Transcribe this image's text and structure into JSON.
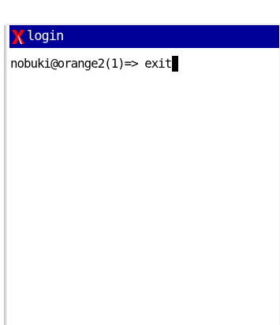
{
  "window": {
    "title": "login",
    "app_icon": "x-window-icon"
  },
  "terminal": {
    "command_line": "nobuki@orange2(1)=> exit",
    "cursor": "block-cursor"
  },
  "colors": {
    "titlebar": "#000099",
    "title_text": "#ffffff",
    "icon": "#ff0000",
    "terminal_background": "#ffffff",
    "terminal_text": "#000000"
  }
}
